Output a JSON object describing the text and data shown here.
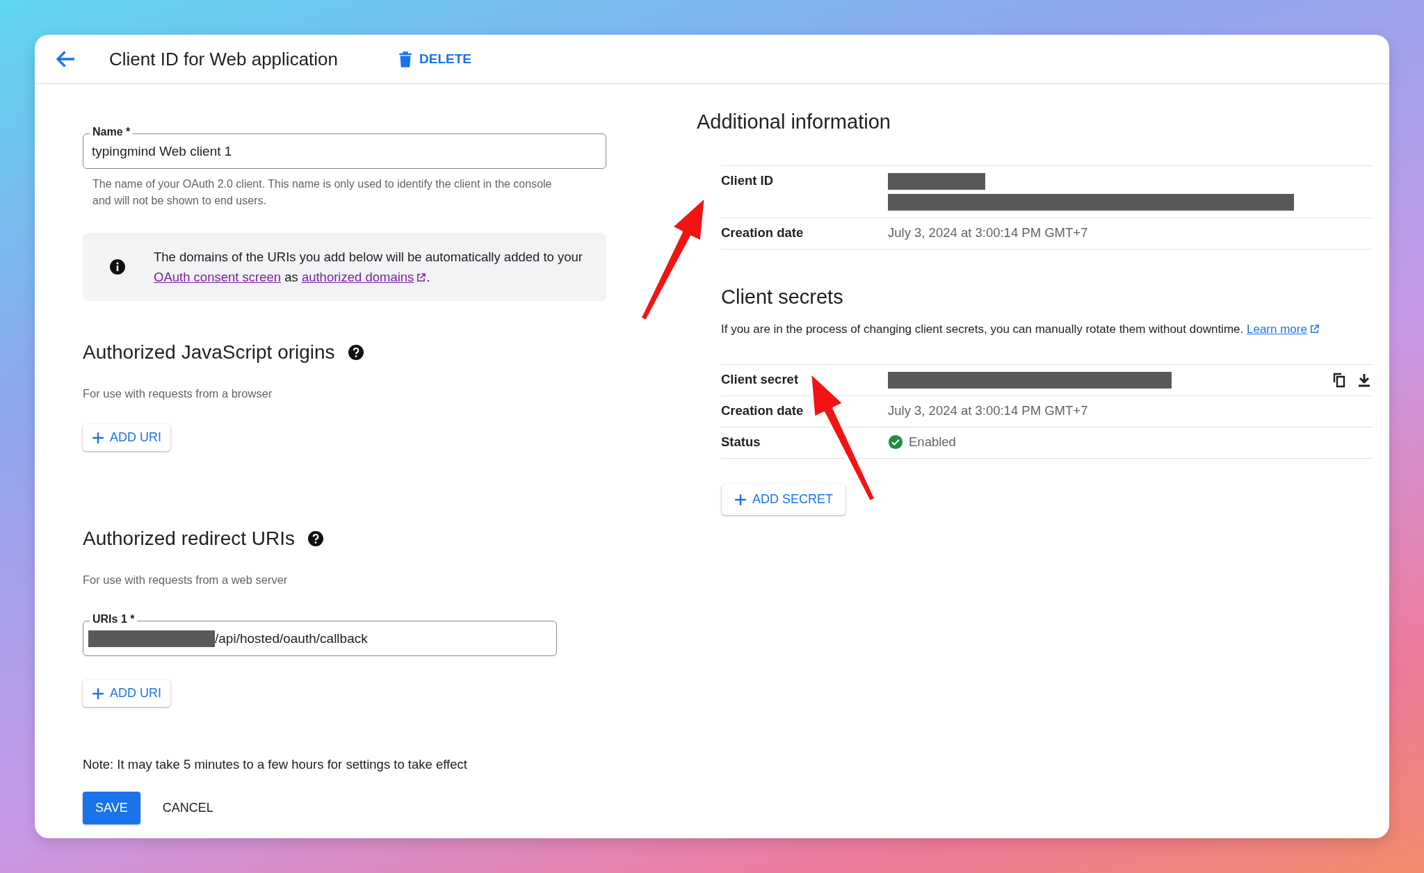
{
  "header": {
    "title": "Client ID for Web application",
    "delete_label": "DELETE"
  },
  "name_field": {
    "label": "Name *",
    "value": "typingmind Web client 1",
    "helper": "The name of your OAuth 2.0 client. This name is only used to identify the client in the console and will not be shown to end users."
  },
  "info_notice": [
    {
      "kind": "text",
      "text": "The domains of the URIs you add below will be automatically added to your "
    },
    {
      "kind": "link",
      "text": "OAuth consent screen"
    },
    {
      "kind": "text",
      "text": " as "
    },
    {
      "kind": "external_link",
      "text": "authorized domains"
    },
    {
      "kind": "text",
      "text": "."
    }
  ],
  "js_origins": {
    "title": "Authorized JavaScript origins",
    "subtitle": "For use with requests from a browser",
    "add_button": "ADD URI"
  },
  "redirect_uris": {
    "title": "Authorized redirect URIs",
    "subtitle": "For use with requests from a web server",
    "uris": [
      {
        "label": "URIs 1 *",
        "value": "/api/hosted/oauth/callback",
        "redacted_prefix": true
      }
    ],
    "add_button": "ADD URI"
  },
  "note": "Note: It may take 5 minutes to a few hours for settings to take effect",
  "actions": [
    {
      "kind": "primary",
      "label": "SAVE"
    },
    {
      "kind": "text",
      "label": "CANCEL"
    }
  ],
  "additional_info": {
    "title": "Additional information",
    "rows": [
      {
        "label": "Client ID",
        "kind": "redacted_two_line"
      },
      {
        "label": "Creation date",
        "kind": "text",
        "value": "July 3, 2024 at 3:00:14 PM GMT+7"
      }
    ]
  },
  "client_secrets": {
    "title": "Client secrets",
    "description": "If you are in the process of changing client secrets, you can manually rotate them without downtime.",
    "learn_more": "Learn more",
    "rows": [
      {
        "label": "Client secret",
        "kind": "secret"
      },
      {
        "label": "Creation date",
        "kind": "text",
        "value": "July 3, 2024 at 3:00:14 PM GMT+7"
      },
      {
        "label": "Status",
        "kind": "status",
        "value": "Enabled"
      }
    ],
    "add_button": "ADD SECRET"
  }
}
